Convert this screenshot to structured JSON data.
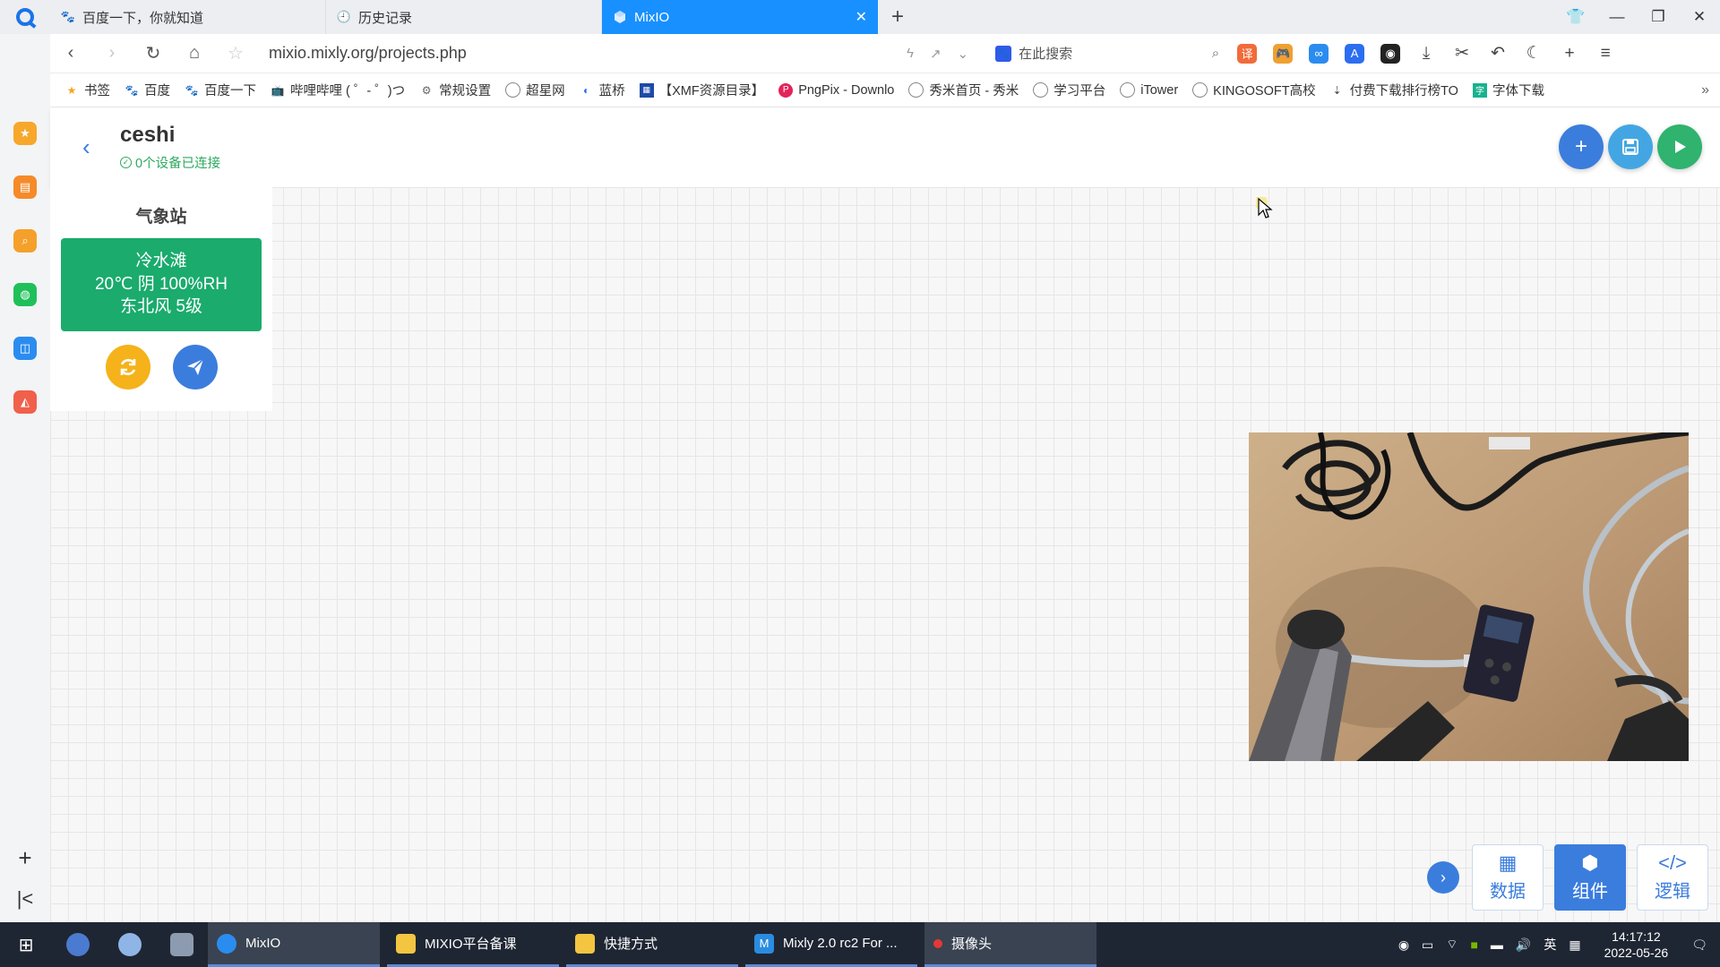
{
  "browser": {
    "tabs": [
      {
        "title": "百度一下，你就知道",
        "icon": "baidu-paw-icon"
      },
      {
        "title": "历史记录",
        "icon": "history-clock-icon"
      },
      {
        "title": "MixIO",
        "icon": "mixio-cube-icon",
        "active": true
      }
    ],
    "new_tab": "+",
    "url": "mixio.mixly.org/projects.php",
    "search_placeholder": "在此搜索",
    "bookmarks": [
      {
        "label": "书签",
        "icon": "star-icon"
      },
      {
        "label": "百度",
        "icon": "baidu-paw-icon"
      },
      {
        "label": "百度一下",
        "icon": "baidu-paw-icon"
      },
      {
        "label": "哔哩哔哩 ( ゜- ゜)つ",
        "icon": "bilibili-tv-icon"
      },
      {
        "label": "常规设置",
        "icon": "gear-icon"
      },
      {
        "label": "超星网",
        "icon": "globe-icon"
      },
      {
        "label": "蓝桥",
        "icon": "lanqiao-icon"
      },
      {
        "label": "【XMF资源目录】",
        "icon": "xmf-icon"
      },
      {
        "label": "PngPix - Downlo",
        "icon": "pngpix-icon"
      },
      {
        "label": "秀米首页 - 秀米",
        "icon": "globe-icon"
      },
      {
        "label": "学习平台",
        "icon": "globe-icon"
      },
      {
        "label": "iTower",
        "icon": "globe-icon"
      },
      {
        "label": "KINGOSOFT高校",
        "icon": "globe-icon"
      },
      {
        "label": "付费下载排行榜TO",
        "icon": "download-icon"
      },
      {
        "label": "字体下载",
        "icon": "font-icon"
      }
    ]
  },
  "app": {
    "project_name": "ceshi",
    "connection_status": "0个设备已连接",
    "colors": {
      "accent": "#3b7ddd",
      "add": "#3b7ddd",
      "save": "#43a6e3",
      "run": "#2fb36e",
      "weather_card": "#1aab6d",
      "refresh": "#f5b21b"
    }
  },
  "widget": {
    "title": "气象站",
    "line1": "冷水滩",
    "line2": "20℃  阴  100%RH",
    "line3": "东北风  5级"
  },
  "mode_buttons": [
    {
      "label": "数据",
      "icon": "table-icon"
    },
    {
      "label": "组件",
      "icon": "cube-icon",
      "active": true
    },
    {
      "label": "逻辑",
      "icon": "code-icon"
    }
  ],
  "taskbar": {
    "tasks": [
      {
        "label": "MixIO",
        "icon": "browser-icon"
      },
      {
        "label": "MIXIO平台备课",
        "icon": "folder-icon"
      },
      {
        "label": "快捷方式",
        "icon": "folder-icon"
      },
      {
        "label": "Mixly 2.0 rc2 For ...",
        "icon": "mixly-icon"
      },
      {
        "label": "摄像头",
        "icon": "camera-record-icon"
      }
    ],
    "ime": "英",
    "time": "14:17:12",
    "date": "2022-05-26"
  }
}
